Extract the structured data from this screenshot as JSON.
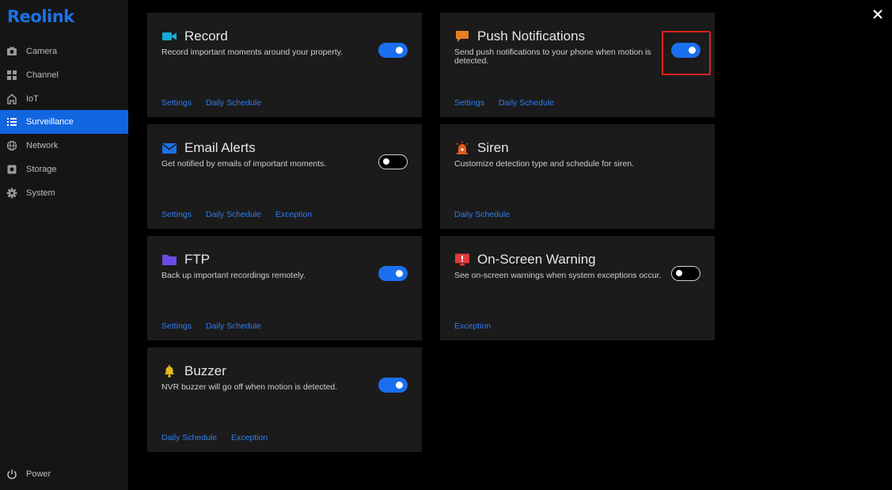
{
  "brand": {
    "logo": "Reolink",
    "accent": "#1a73e8"
  },
  "sidebar": {
    "items": [
      {
        "label": "Camera",
        "icon": "camera-icon"
      },
      {
        "label": "Channel",
        "icon": "grid-icon"
      },
      {
        "label": "IoT",
        "icon": "home-icon"
      },
      {
        "label": "Surveillance",
        "icon": "list-icon",
        "active": true
      },
      {
        "label": "Network",
        "icon": "globe-icon"
      },
      {
        "label": "Storage",
        "icon": "hard-drive-icon"
      },
      {
        "label": "System",
        "icon": "gear-icon"
      }
    ],
    "power": {
      "label": "Power",
      "icon": "power-icon"
    }
  },
  "cards": {
    "record": {
      "title": "Record",
      "desc": "Record important moments around your property.",
      "enabled": true,
      "links": [
        "Settings",
        "Daily Schedule"
      ],
      "icon": "video-camera-icon"
    },
    "push": {
      "title": "Push Notifications",
      "desc": "Send push notifications to your phone when motion is detected.",
      "enabled": true,
      "links": [
        "Settings",
        "Daily Schedule"
      ],
      "icon": "chat-bubble-icon"
    },
    "email": {
      "title": "Email Alerts",
      "desc": "Get notified by emails of important moments.",
      "enabled": false,
      "links": [
        "Settings",
        "Daily Schedule",
        "Exception"
      ],
      "icon": "envelope-icon"
    },
    "siren": {
      "title": "Siren",
      "desc": "Customize detection type and schedule for siren.",
      "links": [
        "Daily Schedule"
      ],
      "icon": "siren-icon"
    },
    "ftp": {
      "title": "FTP",
      "desc": "Back up important recordings remotely.",
      "enabled": true,
      "links": [
        "Settings",
        "Daily Schedule"
      ],
      "icon": "folder-icon"
    },
    "onscreen": {
      "title": "On-Screen Warning",
      "desc": "See on-screen warnings when system exceptions occur.",
      "enabled": false,
      "links": [
        "Exception"
      ],
      "icon": "monitor-warning-icon"
    },
    "buzzer": {
      "title": "Buzzer",
      "desc": "NVR buzzer will go off when motion is detected.",
      "enabled": true,
      "links": [
        "Daily Schedule",
        "Exception"
      ],
      "icon": "bell-icon"
    }
  },
  "colors": {
    "toggle_on": "#1a6ff0",
    "link": "#2f7df0",
    "highlight": "#e0201e",
    "sidebar_active": "#1166e0"
  }
}
